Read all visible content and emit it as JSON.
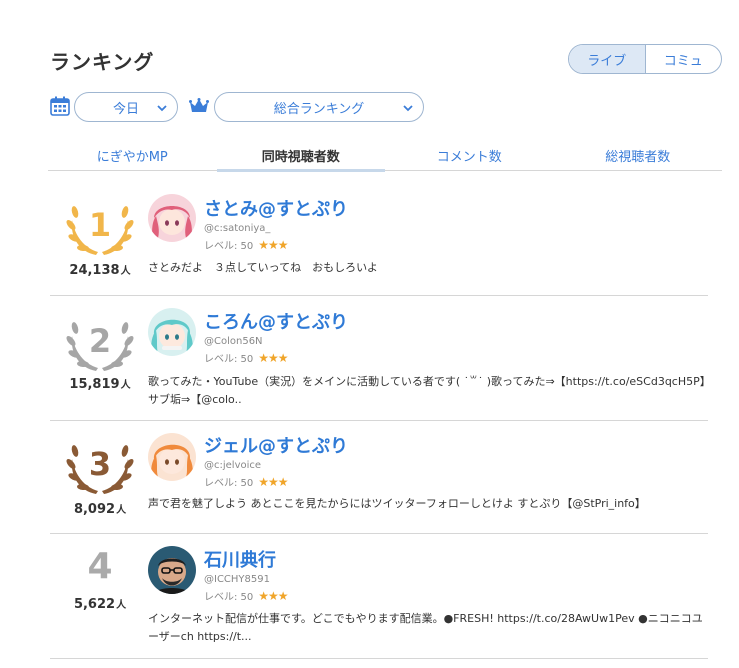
{
  "header": {
    "title": "ランキング"
  },
  "mode_toggle": {
    "live_label": "ライブ",
    "community_label": "コミュ"
  },
  "filters": {
    "date_label": "今日",
    "ranking_label": "総合ランキング"
  },
  "tabs": [
    {
      "label": "にぎやかMP",
      "active": false
    },
    {
      "label": "同時視聴者数",
      "active": true
    },
    {
      "label": "コメント数",
      "active": false
    },
    {
      "label": "総視聴者数",
      "active": false
    }
  ],
  "ranking": [
    {
      "rank": "1",
      "count": "24,138",
      "unit": "人",
      "name": "さとみ@すとぷり",
      "handle": "@c:satoniya_",
      "level": "レベル: 50",
      "stars": "★★★",
      "desc": "さとみだよ　３点していってね　おもしろいよ",
      "medal_color": "#f1b64a"
    },
    {
      "rank": "2",
      "count": "15,819",
      "unit": "人",
      "name": "ころん@すとぷり",
      "handle": "@Colon56N",
      "level": "レベル: 50",
      "stars": "★★★",
      "desc": "歌ってみた・YouTube（実況）をメインに活動している者です( ˙꒳˙ )歌ってみた⇒【https://t.co/eSCd3qcH5P】サブ垢⇒【@colo..",
      "medal_color": "#a6a6a6"
    },
    {
      "rank": "3",
      "count": "8,092",
      "unit": "人",
      "name": "ジェル@すとぷり",
      "handle": "@c:jelvoice",
      "level": "レベル: 50",
      "stars": "★★★",
      "desc": "声で君を魅了しよう あとここを見たからにはツイッターフォローしとけよ すとぷり【@StPri_info】",
      "medal_color": "#8a5a35"
    },
    {
      "rank": "4",
      "count": "5,622",
      "unit": "人",
      "name": "石川典行",
      "handle": "@ICCHY8591",
      "level": "レベル: 50",
      "stars": "★★★",
      "desc": "インターネット配信が仕事です。どこでもやります配信業。●FRESH! https://t.co/28AwUw1Pev ●ニコニコユーザーch https://t...",
      "medal_color": ""
    }
  ]
}
